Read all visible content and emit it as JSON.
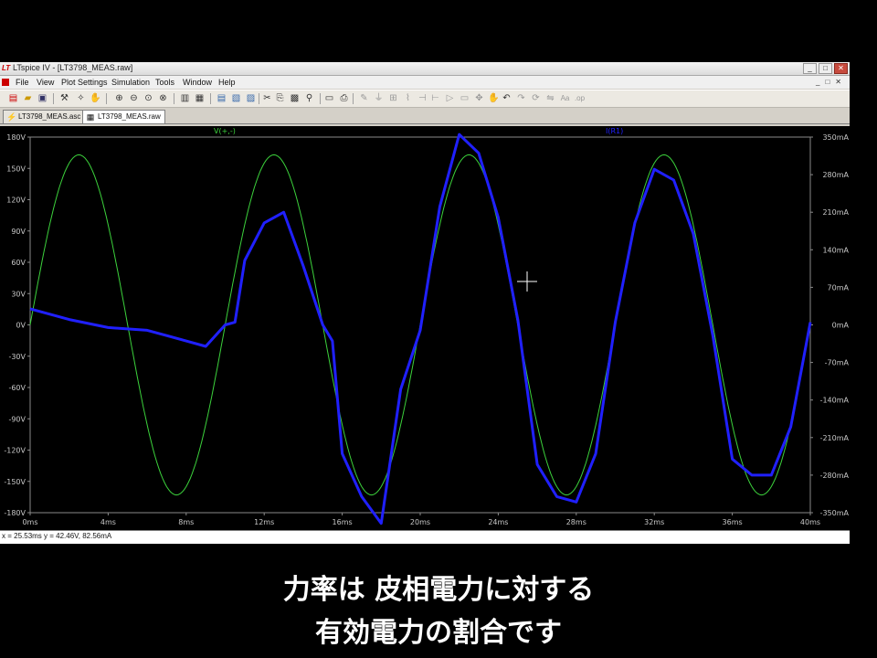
{
  "window": {
    "title": "LTspice IV - [LT3798_MEAS.raw]",
    "logo": "LT"
  },
  "menu": [
    "File",
    "View",
    "Plot Settings",
    "Simulation",
    "Tools",
    "Window",
    "Help"
  ],
  "toolbar_icons": [
    "new-schematic-icon",
    "open-icon",
    "save-icon",
    "control-panel-icon",
    "run-icon",
    "halt-icon",
    "zoom-in-icon",
    "zoom-out-icon",
    "zoom-area-icon",
    "zoom-fit-icon",
    "autorange-icon",
    "tile-vertical-icon",
    "tile-horizontal-icon",
    "cascade-icon",
    "cut-icon",
    "copy-icon",
    "paste-icon",
    "find-icon",
    "print-icon",
    "print-preview-icon",
    "draw-wire-icon",
    "ground-icon",
    "label-icon",
    "resistor-icon",
    "capacitor-icon",
    "inductor-icon",
    "diode-icon",
    "component-icon",
    "move-icon",
    "drag-icon",
    "undo-icon",
    "redo-icon",
    "rotate-icon",
    "mirror-icon",
    "text-icon",
    "spice-directive-icon"
  ],
  "tabs": [
    {
      "label": "LT3798_MEAS.asc",
      "icon": "schematic-icon",
      "active": false
    },
    {
      "label": "LT3798_MEAS.raw",
      "icon": "waveform-icon",
      "active": true
    }
  ],
  "plot": {
    "trace_v_label": "V(+,-)",
    "trace_i_label": "I(R1)",
    "trace_v_color": "#3cd23c",
    "trace_i_color": "#2020ff",
    "cursor": "crosshair",
    "left_ticks": [
      "180V",
      "150V",
      "120V",
      "90V",
      "60V",
      "30V",
      "0V",
      "-30V",
      "-60V",
      "-90V",
      "-120V",
      "-150V",
      "-180V"
    ],
    "right_ticks": [
      "350mA",
      "280mA",
      "210mA",
      "140mA",
      "70mA",
      "0mA",
      "-70mA",
      "-140mA",
      "-210mA",
      "-280mA",
      "-350mA"
    ],
    "x_ticks": [
      "0ms",
      "4ms",
      "8ms",
      "12ms",
      "16ms",
      "20ms",
      "24ms",
      "28ms",
      "32ms",
      "36ms",
      "40ms"
    ]
  },
  "status": {
    "cursor_readout": "x = 25.53ms    y = 42.46V, 82.56mA"
  },
  "subtitles": {
    "line1": "力率は 皮相電力に対する",
    "line2": "有効電力の割合です"
  },
  "chart_data": {
    "type": "line",
    "xlabel": "",
    "ylabel": "",
    "xlim": [
      0,
      40
    ],
    "ylim": [
      -180,
      180
    ],
    "y2lim": [
      -350,
      350
    ],
    "x_unit": "ms",
    "series": [
      {
        "name": "V(+,-)",
        "axis": "left",
        "x": [
          0,
          1.25,
          2.5,
          3.75,
          5,
          6.25,
          7.5,
          8.75,
          10,
          11.25,
          12.5,
          13.75,
          15,
          16.25,
          17.5,
          18.75,
          20,
          21.25,
          22.5,
          23.75,
          25,
          26.25,
          27.5,
          28.75,
          30,
          31.25,
          32.5,
          33.75,
          35,
          36.25,
          37.5,
          38.75,
          40
        ],
        "y": [
          0,
          115,
          163,
          115,
          0,
          -115,
          -163,
          -115,
          0,
          115,
          163,
          115,
          0,
          -115,
          -163,
          -115,
          0,
          115,
          163,
          115,
          0,
          -115,
          -163,
          -115,
          0,
          115,
          163,
          115,
          0,
          -115,
          -163,
          -115,
          0
        ]
      },
      {
        "name": "I(R1)",
        "axis": "right",
        "x": [
          0,
          2,
          4,
          6,
          7,
          8,
          9,
          10,
          10.5,
          11,
          12,
          13,
          14,
          15,
          15.5,
          16,
          17,
          18,
          19,
          20,
          21,
          22,
          23,
          24,
          25,
          26,
          27,
          28,
          29,
          30,
          31,
          32,
          33,
          34,
          35,
          36,
          37,
          38,
          39,
          40
        ],
        "y": [
          30,
          10,
          -5,
          -10,
          -20,
          -30,
          -40,
          0,
          5,
          120,
          190,
          210,
          110,
          0,
          -30,
          -240,
          -320,
          -370,
          -120,
          -10,
          220,
          355,
          320,
          200,
          10,
          -260,
          -320,
          -330,
          -240,
          5,
          190,
          290,
          270,
          170,
          -20,
          -250,
          -280,
          -280,
          -190,
          5
        ]
      }
    ]
  }
}
